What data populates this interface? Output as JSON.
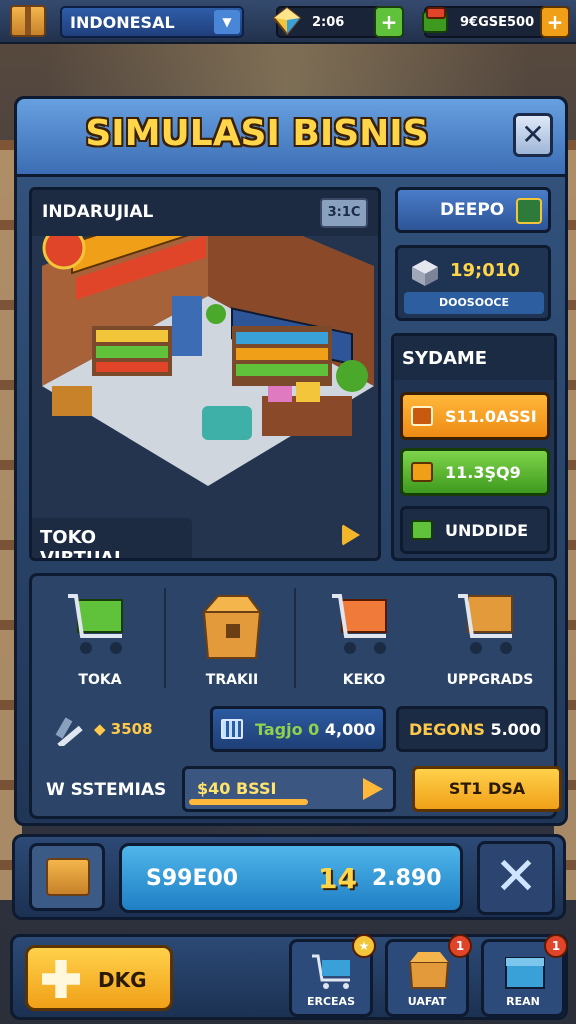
{
  "topbar": {
    "region_select": "INDONESAL",
    "gems": "2:06",
    "coins": "9€GSE500"
  },
  "panel": {
    "title": "SIMULASI BISNIS",
    "store": {
      "name": "INDARUJIAL",
      "badge": "3:1C",
      "footer": "TOKO VIRTUAL"
    },
    "depo_label": "DEEPO",
    "stat_card": {
      "value": "19;010",
      "sub": "DOOSOOCE"
    },
    "sydame": {
      "title": "SYDAME",
      "option_orange": "S11.0ASSI",
      "option_green": "11.3ŞQ9",
      "option_dark": "UNDDIDE"
    }
  },
  "shop": {
    "items": [
      {
        "label": "TOKA"
      },
      {
        "label": "TRAKII"
      },
      {
        "label": "KEKO"
      },
      {
        "label": "UPPGRADS"
      }
    ],
    "tool_value": "3508",
    "stat_mid_a": "Tagjo 0",
    "stat_mid_b": "4,000",
    "stat_right_a": "DEGONS",
    "stat_right_b": "5.000",
    "systems_label": "W SSTEMIAS",
    "progress_text": "$40 BSSI",
    "progress_fraction": 0.6,
    "gold_button": "ST1 DSA"
  },
  "summary": {
    "left": "S99E00",
    "highlight": "14",
    "right": "2.890"
  },
  "bottom": {
    "main_button": "DKG",
    "nav": [
      {
        "label": "ERCEAS",
        "badge": "★",
        "badge_color": "#f3c53a"
      },
      {
        "label": "UAFAT",
        "badge": "1",
        "badge_color": "#e0452a"
      },
      {
        "label": "REAN",
        "badge": "1",
        "badge_color": "#e0452a"
      }
    ]
  }
}
